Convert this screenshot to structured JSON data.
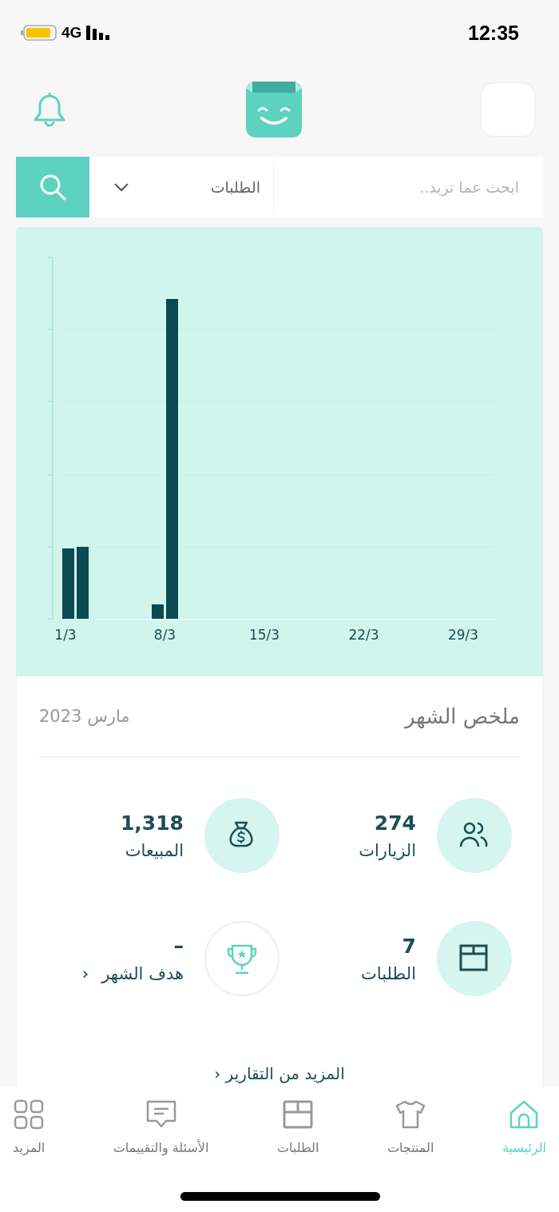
{
  "status_bar": {
    "time": "12:35",
    "network": "4G"
  },
  "search": {
    "placeholder": "ابحث عما تريد..",
    "category": "الطلبات"
  },
  "chart": {
    "x_labels": [
      "29/3",
      "22/3",
      "15/3",
      "8/3",
      "1/3"
    ]
  },
  "summary": {
    "title": "ملخص الشهر",
    "period": "مارس 2023",
    "stats": [
      {
        "kind": "stat",
        "value": "274",
        "label": "الزيارات"
      },
      {
        "kind": "stat",
        "value": "1,318",
        "label": "المبيعات"
      },
      {
        "kind": "stat",
        "value": "7",
        "label": "الطلبات"
      },
      {
        "kind": "goal",
        "value": "–",
        "label": "هدف الشهر",
        "link_arrow": "‹"
      }
    ],
    "more_link": "المزيد من التقارير",
    "more_arrow": "‹"
  },
  "tab_bar": [
    {
      "label": "الرئيسية",
      "selected": true
    },
    {
      "label": "المنتجات",
      "selected": false
    },
    {
      "label": "الطلبات",
      "selected": false
    },
    {
      "label": "الأسئلة والتقييمات",
      "selected": false
    },
    {
      "label": "المزيد",
      "selected": false
    }
  ]
}
